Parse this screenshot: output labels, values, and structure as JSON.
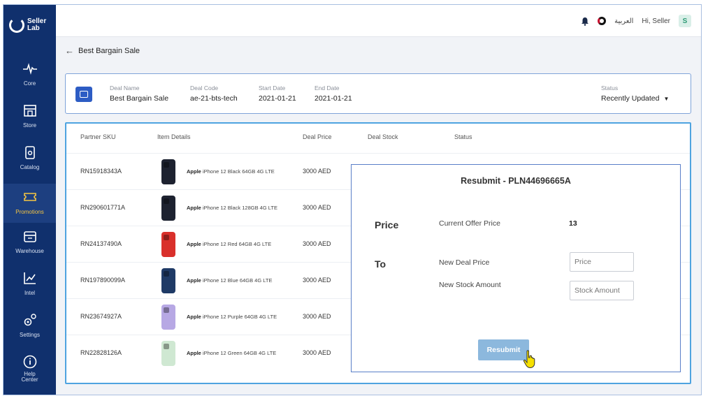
{
  "brand": {
    "name_line1": "Seller",
    "name_line2": "Lab"
  },
  "sidebar": {
    "items": [
      {
        "label": "Core",
        "icon": "pulse-icon"
      },
      {
        "label": "Store",
        "icon": "store-icon"
      },
      {
        "label": "Catalog",
        "icon": "catalog-icon"
      },
      {
        "label": "Promotions",
        "icon": "ticket-icon",
        "active": true
      },
      {
        "label": "Warehouse",
        "icon": "warehouse-icon"
      },
      {
        "label": "Intel",
        "icon": "chart-icon"
      },
      {
        "label": "Settings",
        "icon": "gear-icon"
      },
      {
        "label": "Help Center",
        "icon": "info-icon"
      }
    ]
  },
  "topbar": {
    "language": "العربية",
    "greeting": "Hi, Seller",
    "avatar_initial": "S"
  },
  "breadcrumb": {
    "title": "Best Bargain Sale"
  },
  "deal": {
    "name_label": "Deal Name",
    "name": "Best Bargain Sale",
    "code_label": "Deal Code",
    "code": "ae-21-bts-tech",
    "start_label": "Start Date",
    "start": "2021-01-21",
    "end_label": "End Date",
    "end": "2021-01-21",
    "status_label": "Status",
    "status": "Recently Updated"
  },
  "table": {
    "headers": {
      "sku": "Partner SKU",
      "item": "Item Details",
      "price": "Deal Price",
      "stock": "Deal Stock",
      "status": "Status"
    },
    "rows": [
      {
        "sku": "RN15918343A",
        "brand": "Apple",
        "item": "iPhone 12 Black 64GB 4G LTE",
        "price": "3000 AED",
        "color": "#1d2230"
      },
      {
        "sku": "RN290601771A",
        "brand": "Apple",
        "item": "iPhone 12 Black 128GB 4G LTE",
        "price": "3000 AED",
        "color": "#1d2230"
      },
      {
        "sku": "RN24137490A",
        "brand": "Apple",
        "item": "iPhone 12 Red 64GB 4G LTE",
        "price": "3000 AED",
        "color": "#d9302b"
      },
      {
        "sku": "RN197890099A",
        "brand": "Apple",
        "item": "iPhone 12 Blue 64GB 4G LTE",
        "price": "3000 AED",
        "color": "#1f3a66"
      },
      {
        "sku": "RN23674927A",
        "brand": "Apple",
        "item": "iPhone 12 Purple 64GB 4G LTE",
        "price": "3000 AED",
        "color": "#b7a8e4"
      },
      {
        "sku": "RN22828126A",
        "brand": "Apple",
        "item": "iPhone 12 Green 64GB 4G LTE",
        "price": "3000 AED",
        "color": "#cfe8d2"
      }
    ]
  },
  "modal": {
    "title": "Resubmit - PLN44696665A",
    "price_label": "Price",
    "current_offer_label": "Current Offer Price",
    "current_offer_value": "13",
    "to_label": "To",
    "new_price_label": "New Deal Price",
    "new_price_placeholder": "Price",
    "new_stock_label": "New Stock Amount",
    "new_stock_placeholder": "Stock Amount",
    "submit_label": "Resubmit"
  },
  "colors": {
    "sidebar": "#10306d",
    "accent": "#4ea3e0",
    "button": "#8cb8dd",
    "active_label": "#f5c542"
  }
}
